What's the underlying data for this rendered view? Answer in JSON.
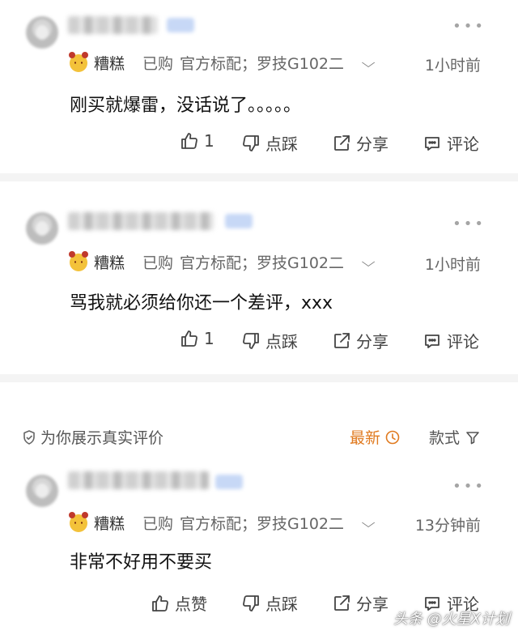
{
  "reviews": [
    {
      "level_label": "糟糕",
      "purchased": "已购",
      "spec": "官方标配；罗技G102二",
      "time": "1小时前",
      "content": "刚买就爆雷，没话说了。。。。。",
      "actions": {
        "like": "1",
        "dislike": "点踩",
        "share": "分享",
        "comment": "评论"
      }
    },
    {
      "level_label": "糟糕",
      "purchased": "已购",
      "spec": "官方标配；罗技G102二",
      "time": "1小时前",
      "content": "骂我就必须给你还一个差评，xxx",
      "actions": {
        "like": "1",
        "dislike": "点踩",
        "share": "分享",
        "comment": "评论"
      }
    },
    {
      "level_label": "糟糕",
      "purchased": "已购",
      "spec": "官方标配；罗技G102二",
      "time": "13分钟前",
      "content": "非常不好用不要买",
      "actions": {
        "like": "点赞",
        "dislike": "点踩",
        "share": "分享",
        "comment": "评论"
      }
    }
  ],
  "filter_bar": {
    "authentic": "为你展示真实评价",
    "sort_latest": "最新",
    "sort_style": "款式"
  },
  "watermark": "头条 @火星X计划",
  "icons": [
    "avatar",
    "bear-icon",
    "more-icon",
    "chevron-down-icon",
    "thumb-up-icon",
    "thumb-down-icon",
    "share-icon",
    "comment-icon",
    "check-shield-icon",
    "clock-icon",
    "filter-icon"
  ],
  "colors": {
    "accent": "#e07a1f",
    "text": "#1f1f1f",
    "muted": "#666666",
    "divider": "#f4f4f4"
  }
}
